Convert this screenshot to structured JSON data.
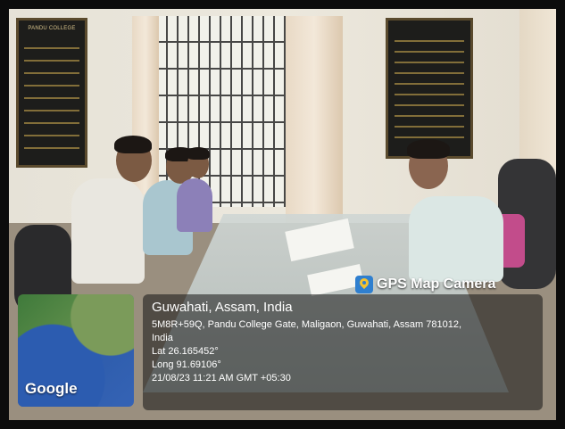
{
  "scene": {
    "board_left_heading": "PANDU COLLEGE"
  },
  "gps": {
    "brand": "GPS Map Camera",
    "location_title": "Guwahati, Assam, India",
    "address_line1": "5M8R+59Q, Pandu College Gate, Maligaon, Guwahati, Assam 781012,",
    "address_line2": "India",
    "lat": "Lat 26.165452°",
    "long": "Long 91.69106°",
    "timestamp": "21/08/23 11:21 AM GMT +05:30"
  },
  "map": {
    "provider": "Google"
  },
  "colors": {
    "overlay_bg": "#141414",
    "brand_icon": "#2f7fcf",
    "pin": "#f4c22f"
  }
}
